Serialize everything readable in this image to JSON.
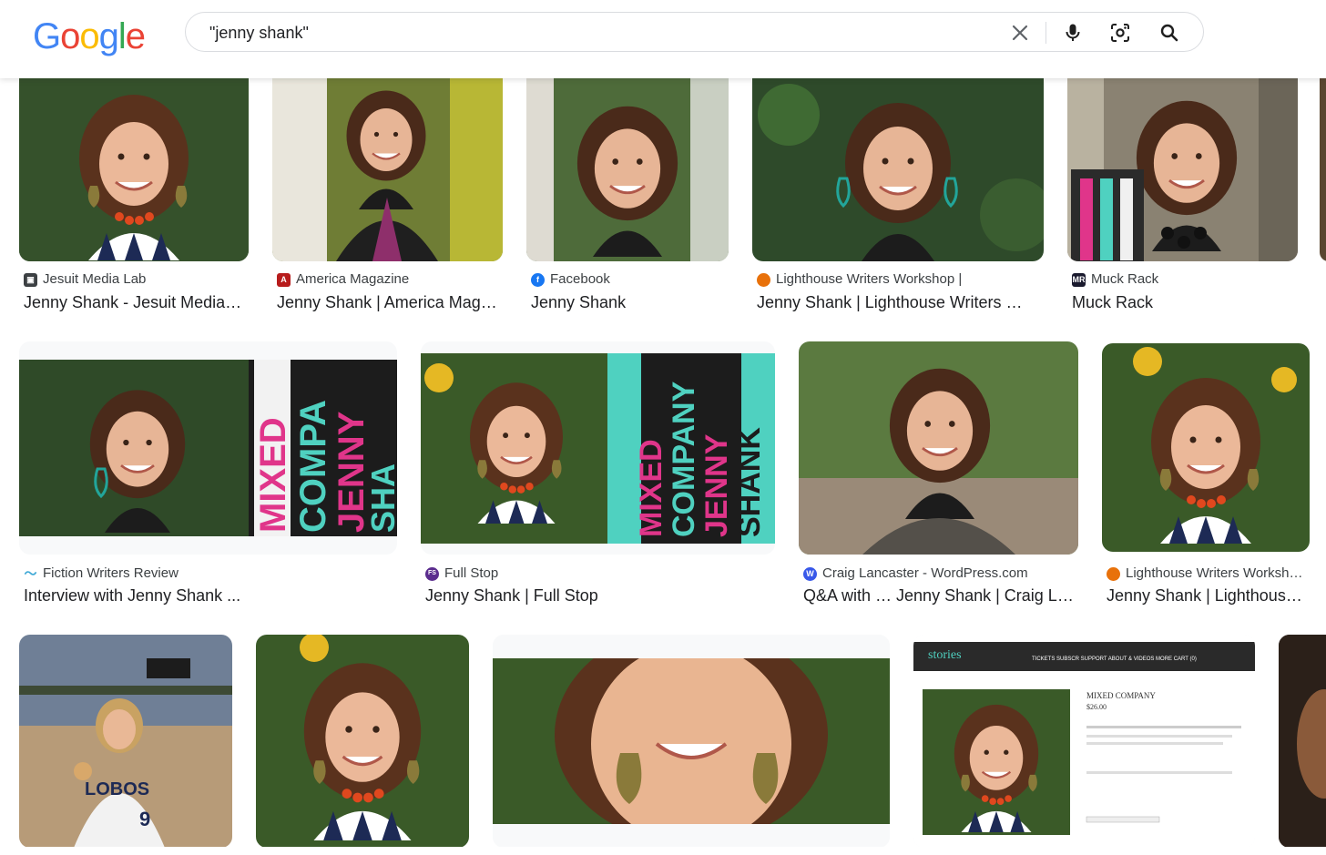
{
  "search": {
    "query": "\"jenny shank\""
  },
  "logo": {
    "letters": [
      "G",
      "o",
      "o",
      "g",
      "l",
      "e"
    ],
    "colors": [
      "#4285f4",
      "#ea4335",
      "#fbbc05",
      "#4285f4",
      "#34a853",
      "#ea4335"
    ]
  },
  "results": [
    {
      "source": "Jesuit Media Lab",
      "title": "Jenny Shank - Jesuit Media Lab",
      "favicon": "jesuit-media-lab-favicon",
      "favicon_color": "#3c4043"
    },
    {
      "source": "America Magazine",
      "title": "Jenny Shank | America Magazine",
      "favicon": "america-magazine-favicon",
      "favicon_color": "#b71c1c"
    },
    {
      "source": "Facebook",
      "title": "Jenny Shank",
      "favicon": "facebook-favicon",
      "favicon_color": "#1877f2"
    },
    {
      "source": "Lighthouse Writers Workshop |",
      "title": "Jenny Shank | Lighthouse Writers Workshop",
      "favicon": "lighthouse-favicon",
      "favicon_color": "#e8710a"
    },
    {
      "source": "Muck Rack",
      "title": "Muck Rack",
      "favicon": "muck-rack-favicon",
      "favicon_color": "#1a1a2e"
    },
    {
      "source": "Fiction Writers Review",
      "title": "Interview with Jenny Shank ...",
      "favicon": "fiction-writers-review-favicon",
      "favicon_color": "#3fa9d6"
    },
    {
      "source": "Full Stop",
      "title": "Jenny Shank | Full Stop",
      "favicon": "full-stop-favicon",
      "favicon_color": "#5b2d8e"
    },
    {
      "source": "Craig Lancaster - WordPress.com",
      "title": "Q&A with … Jenny Shank | Craig Lancaster",
      "favicon": "wordpress-favicon",
      "favicon_color": "#3858e9"
    },
    {
      "source": "Lighthouse Writers Workshop",
      "title": "Jenny Shank | Lighthouse Writers Workshop",
      "favicon": "lighthouse-favicon",
      "favicon_color": "#e8710a"
    }
  ],
  "colors": {
    "accent_teal": "#4fd1c0",
    "accent_pink": "#e0358a",
    "text": "#202124",
    "subtext": "#3c4043"
  }
}
